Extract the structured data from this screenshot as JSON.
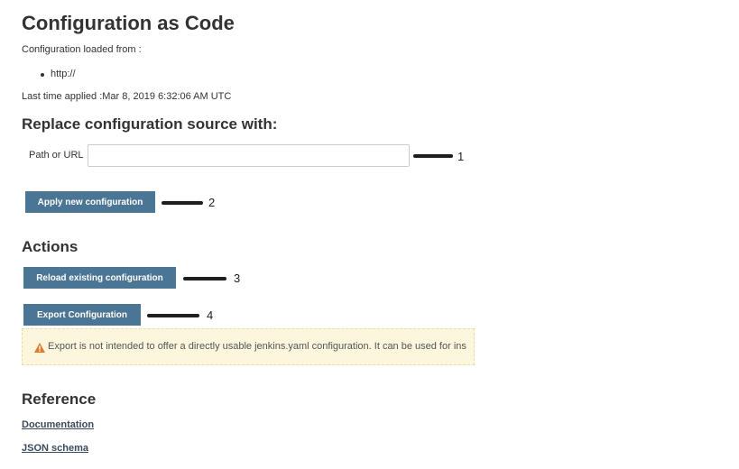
{
  "page": {
    "title": "Configuration as Code",
    "loaded_from_label": "Configuration loaded from :",
    "sources": [
      "http://"
    ],
    "last_applied": "Last time applied :Mar 8, 2019 6:32:06 AM UTC"
  },
  "replace": {
    "heading": "Replace configuration source with:",
    "path_label": "Path or URL",
    "path_value": "",
    "path_placeholder": "",
    "apply_button": "Apply new configuration"
  },
  "actions": {
    "heading": "Actions",
    "reload_button": "Reload existing configuration",
    "export_button": "Export Configuration",
    "warning_icon": "warning-icon",
    "warning_text": "Export is not intended to offer a directly usable jenkins.yaml configuration. It can be used for ins"
  },
  "reference": {
    "heading": "Reference",
    "links": [
      "Documentation",
      "JSON schema"
    ]
  },
  "annotations": [
    "1",
    "2",
    "3",
    "4"
  ],
  "colors": {
    "button": "#4b7594",
    "warning_bg": "#fbf6dc",
    "warning_icon": "#e07b2a"
  }
}
